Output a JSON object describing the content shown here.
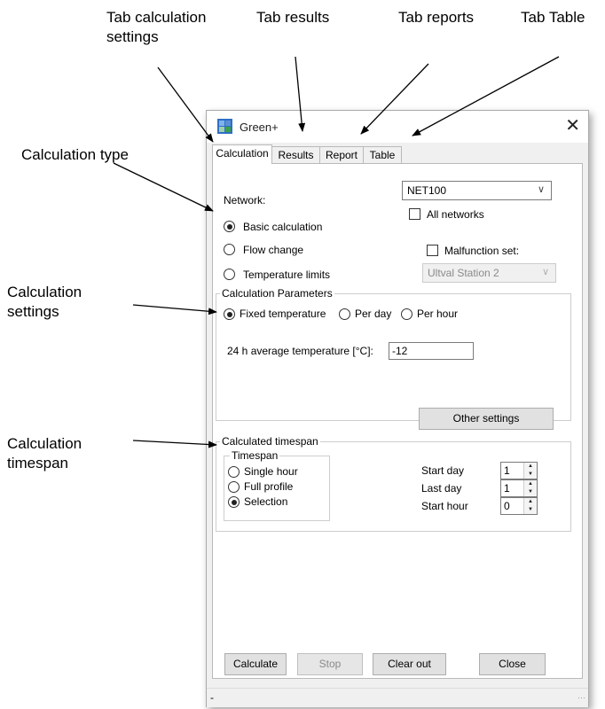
{
  "annotations": {
    "tab_calc_line1": "Tab calculation",
    "tab_calc_line2": "settings",
    "tab_results": "Tab results",
    "tab_reports": "Tab reports",
    "tab_table": "Tab Table",
    "calc_type": "Calculation type",
    "calc_settings_line1": "Calculation",
    "calc_settings_line2": "settings",
    "calc_timespan_line1": "Calculation",
    "calc_timespan_line2": "timespan"
  },
  "window": {
    "title": "Green+",
    "close_glyph": "✕",
    "app_icon": "green-plus-app-icon"
  },
  "tabs": [
    {
      "label": "Calculation",
      "active": true
    },
    {
      "label": "Results",
      "active": false
    },
    {
      "label": "Report",
      "active": false
    },
    {
      "label": "Table",
      "active": false
    }
  ],
  "network": {
    "label": "Network:",
    "selected": "NET100",
    "all_networks_label": "All networks",
    "all_networks_checked": false,
    "malfunction_label": "Malfunction set:",
    "malfunction_checked": false,
    "malfunction_value": "Ultval Station 2"
  },
  "calc_types": [
    {
      "label": "Basic calculation",
      "selected": true
    },
    {
      "label": "Flow change",
      "selected": false
    },
    {
      "label": "Temperature limits",
      "selected": false
    }
  ],
  "parameters": {
    "group_title": "Calculation Parameters",
    "options": [
      {
        "label": "Fixed temperature",
        "selected": true
      },
      {
        "label": "Per day",
        "selected": false
      },
      {
        "label": "Per hour",
        "selected": false
      }
    ],
    "avg_temp_label": "24 h average temperature [°C]:",
    "avg_temp_value": "-12",
    "other_settings_label": "Other settings"
  },
  "timespan": {
    "group_title": "Calculated timespan",
    "inner_title": "Timespan",
    "options": [
      {
        "label": "Single hour",
        "selected": false
      },
      {
        "label": "Full profile",
        "selected": false
      },
      {
        "label": "Selection",
        "selected": true
      }
    ],
    "start_day_label": "Start day",
    "start_day_value": "1",
    "last_day_label": "Last day",
    "last_day_value": "1",
    "start_hour_label": "Start hour",
    "start_hour_value": "0"
  },
  "buttons": {
    "calculate": "Calculate",
    "stop": "Stop",
    "clear_out": "Clear out",
    "close": "Close"
  },
  "status": {
    "text": "-"
  },
  "colors": {
    "icon_blue": "#2f6fc4",
    "icon_green": "#3aa14a"
  }
}
